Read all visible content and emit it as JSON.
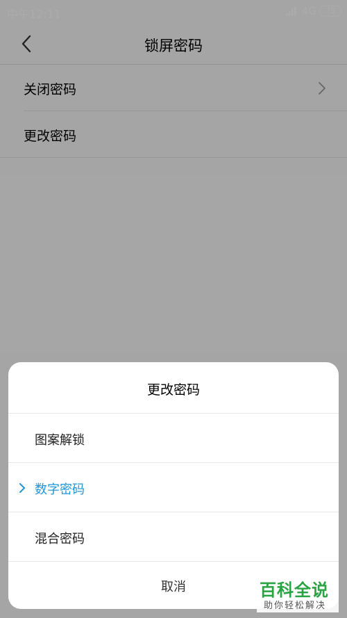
{
  "status_bar": {
    "time": "中午12:11",
    "network": "4G",
    "battery": "75"
  },
  "header": {
    "title": "锁屏密码",
    "back_icon": "chevron-left-icon"
  },
  "menu": {
    "items": [
      {
        "label": "关闭密码",
        "icon": "chevron-right-icon"
      },
      {
        "label": "更改密码"
      }
    ]
  },
  "dialog": {
    "title": "更改密码",
    "options": [
      {
        "label": "图案解锁",
        "selected": false
      },
      {
        "label": "数字密码",
        "selected": true
      },
      {
        "label": "混合密码",
        "selected": false
      }
    ],
    "cancel_label": "取消",
    "accent_color": "#2196d8"
  },
  "watermark": {
    "title": "百科全说",
    "subtitle": "助你轻松解决"
  }
}
